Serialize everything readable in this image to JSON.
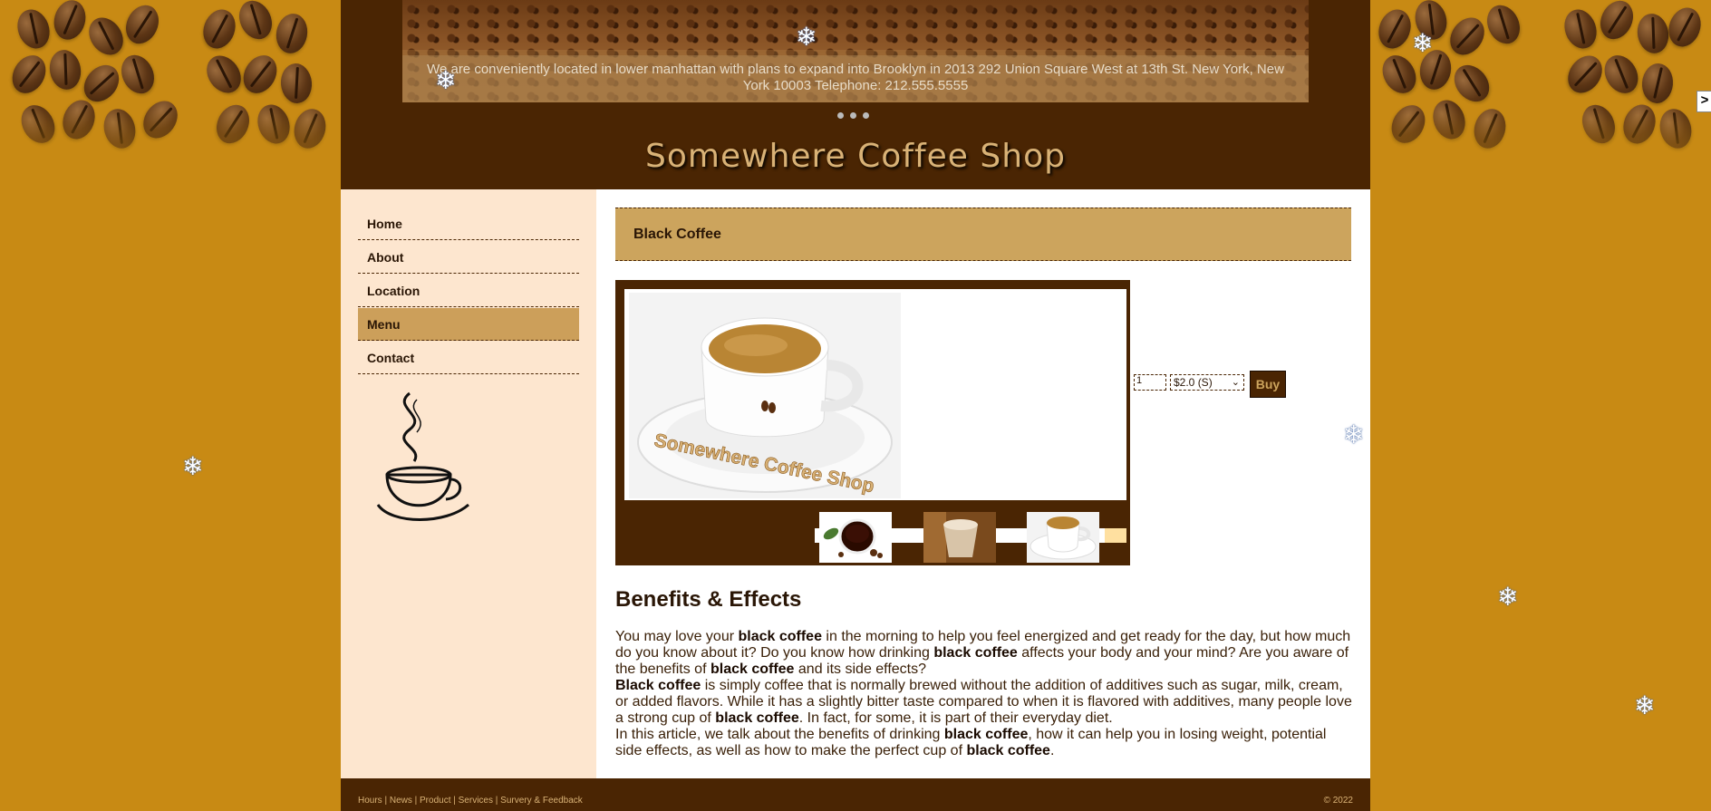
{
  "banner": {
    "caption": "We are conveniently located in lower manhattan with plans to expand into Brooklyn in 2013 292 Union Square West at 13th St. New York, New York 10003 Telephone: 212.555.5555",
    "slide_count": 3
  },
  "site": {
    "title": "Somewhere Coffee Shop"
  },
  "nav": {
    "items": [
      {
        "label": "Home",
        "active": false
      },
      {
        "label": "About",
        "active": false
      },
      {
        "label": "Location",
        "active": false
      },
      {
        "label": "Menu",
        "active": true
      },
      {
        "label": "Contact",
        "active": false
      }
    ]
  },
  "product": {
    "title": "Black Coffee",
    "photo_caption": "Somewhere Coffee Shop",
    "quantity": "1",
    "price_option": "$2.0 (S)",
    "buy_label": "Buy"
  },
  "article": {
    "heading": "Benefits & Effects",
    "p1_a": "You may love your ",
    "kw": "black coffee",
    "kw_cap": "Black coffee",
    "p1_b": " in the morning to help you feel energized and get ready for the day, but how much do you know about it? Do you know how drinking ",
    "p1_c": " affects your body and your mind? Are you aware of the benefits of ",
    "p1_d": " and its side effects?",
    "p2_a": " is simply coffee that is normally brewed without the addition of additives such as sugar, milk, cream, or added flavors. While it has a slightly bitter taste compared to when it is flavored with additives, many people love a strong cup of ",
    "p2_b": ". In fact, for some, it is part of their everyday diet.",
    "p3_a": "In this article, we talk about the benefits of drinking ",
    "p3_b": ", how it can help you in losing weight, potential side effects, as well as how to make the perfect cup of ",
    "p3_c": "."
  },
  "footer": {
    "links": [
      "Hours",
      "News",
      "Product",
      "Services",
      "Survery & Feedback"
    ],
    "separator": " | ",
    "copyright": "© 2022"
  },
  "next_arrow": ">",
  "colors": {
    "page_bg": "#c88a14",
    "header_bg": "#4a2503",
    "accent": "#cca45d",
    "sidebar_bg": "#fde6cf",
    "title_text": "#d9b276"
  }
}
